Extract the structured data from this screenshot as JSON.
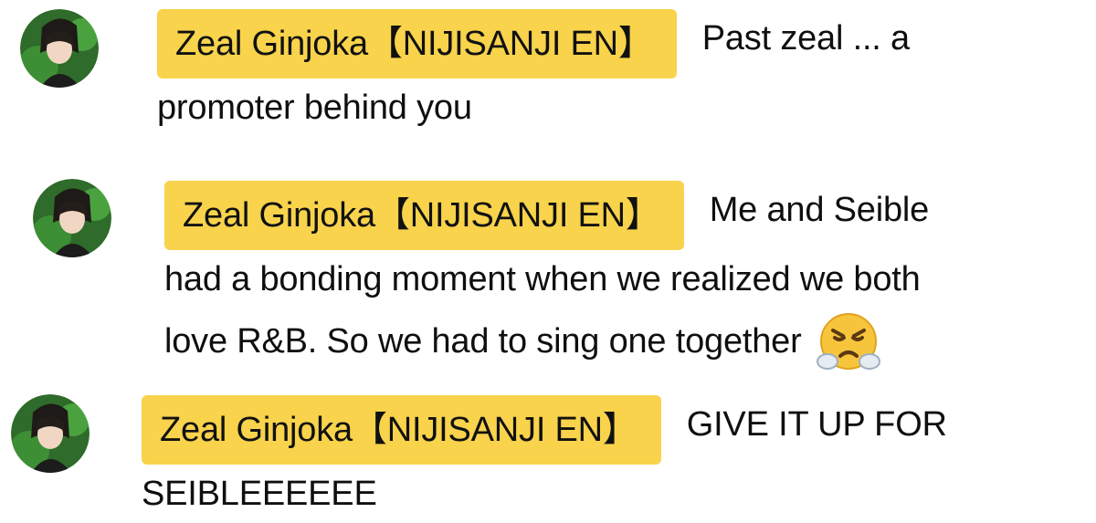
{
  "colors": {
    "author_chip_bg": "#f8d34b",
    "text": "#0f0f0f",
    "background": "#ffffff"
  },
  "messages": [
    {
      "author": "Zeal Ginjoka【NIJISANJI EN】",
      "avatar_icon": "avatar-image",
      "text_line1": "Past zeal ... a",
      "text_line2": "promoter behind you",
      "text_line3": ""
    },
    {
      "author": "Zeal Ginjoka【NIJISANJI EN】",
      "avatar_icon": "avatar-image",
      "text_line1": "Me and Seible",
      "text_line2": "had a bonding moment when we realized we both",
      "text_line3": "love R&B. So we had to sing one together",
      "emoji": "face-with-steam-from-nose-emoji"
    },
    {
      "author": "Zeal Ginjoka【NIJISANJI EN】",
      "avatar_icon": "avatar-image",
      "text_line1": "GIVE IT UP FOR",
      "text_line2": "SEIBLEEEEEE",
      "text_line3": ""
    }
  ]
}
